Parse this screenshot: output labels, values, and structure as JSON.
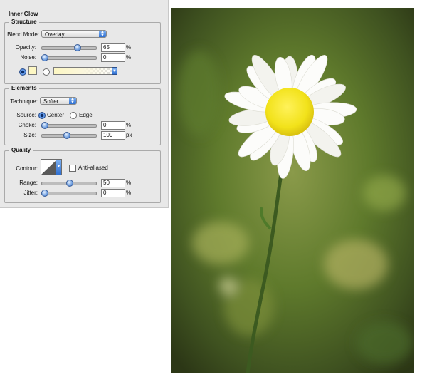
{
  "panel": {
    "title": "Inner Glow",
    "structure": {
      "legend": "Structure",
      "blend_mode": {
        "label": "Blend Mode:",
        "value": "Overlay"
      },
      "opacity": {
        "label": "Opacity:",
        "value": "65",
        "unit": "%",
        "level": 0.65
      },
      "noise": {
        "label": "Noise:",
        "value": "0",
        "unit": "%",
        "level": 0
      },
      "glow_color": "#fdf7c3",
      "gradient_selected": false
    },
    "elements": {
      "legend": "Elements",
      "technique": {
        "label": "Technique:",
        "value": "Softer"
      },
      "source": {
        "label": "Source:",
        "center": "Center",
        "edge": "Edge",
        "selected": "Center"
      },
      "choke": {
        "label": "Choke:",
        "value": "0",
        "unit": "%",
        "level": 0
      },
      "size": {
        "label": "Size:",
        "value": "109",
        "unit": "px",
        "level": 0.44
      }
    },
    "quality": {
      "legend": "Quality",
      "contour": {
        "label": "Contour:"
      },
      "anti_aliased": {
        "label": "Anti-aliased",
        "checked": false
      },
      "range": {
        "label": "Range:",
        "value": "50",
        "unit": "%",
        "level": 0.5
      },
      "jitter": {
        "label": "Jitter:",
        "value": "0",
        "unit": "%",
        "level": 0
      }
    }
  },
  "colors": {
    "accent": "#2f6fd1",
    "flower_center": "#f2e21a",
    "background": "#4f6a2a"
  }
}
